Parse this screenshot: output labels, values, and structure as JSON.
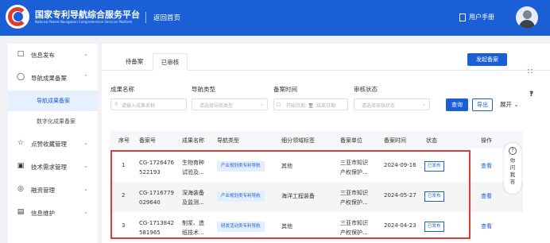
{
  "header": {
    "title": "国家专利导航综合服务平台",
    "subtitle": "National Patent Navigation Comprehensive Services Platform",
    "back_home": "返回首页",
    "manual": "用户手册",
    "brand_color": "#1b5fd6"
  },
  "sidebar": {
    "items": [
      {
        "label": "信息发布",
        "icon": "message-icon"
      },
      {
        "label": "导航成果备案",
        "icon": "shield-icon"
      },
      {
        "label": "点赞收藏管理",
        "icon": "star-icon"
      },
      {
        "label": "技术需求管理",
        "icon": "monitor-icon"
      },
      {
        "label": "融资管理",
        "icon": "target-icon"
      },
      {
        "label": "信息维护",
        "icon": "document-icon"
      }
    ],
    "sub_items": [
      {
        "label": "导航成果备案",
        "active": true
      },
      {
        "label": "数字化成果备案",
        "active": false
      }
    ]
  },
  "tabs": [
    "待备案",
    "已审核"
  ],
  "actions": {
    "launch": "发起备案",
    "query": "查询",
    "export": "导出",
    "expand": "展开"
  },
  "filters": {
    "result_name": {
      "label": "成果名称",
      "placeholder": "请输入成果名称"
    },
    "nav_type": {
      "label": "导航类型",
      "placeholder": "请选择导航类型"
    },
    "filing_time": {
      "label": "备案时间",
      "start": "开始日期",
      "to": "至",
      "end": "结束日期"
    },
    "audit_status": {
      "label": "审核状态",
      "placeholder": "请选择审核状态"
    }
  },
  "table": {
    "headers": [
      "序号",
      "备案号",
      "成果名称",
      "导航类型",
      "细分领域标签",
      "备案单位",
      "备案时间",
      "状态",
      "操作"
    ],
    "rows": [
      {
        "index": "1",
        "no1": "CG-1726476",
        "no2": "522193",
        "name1": "生物育种",
        "name2": "试验及...",
        "type": "产业规划类专利导航",
        "tag": "其他",
        "unit1": "三亚市知识",
        "unit2": "产权保护...",
        "date": "2024-09-16",
        "status": "已发布",
        "op": "查看"
      },
      {
        "index": "2",
        "no1": "CG-1716779",
        "no2": "029640",
        "name1": "深海装备",
        "name2": "及监测...",
        "type": "产业规划类专利导航",
        "tag": "海洋工程装备",
        "unit1": "三亚市知识",
        "unit2": "产权保护...",
        "date": "2024-05-27",
        "status": "已发布",
        "op": "查看"
      },
      {
        "index": "3",
        "no1": "CG-1713842",
        "no2": "581965",
        "name1": "制浆、造",
        "name2": "纸技术...",
        "type": "研发活动类专利导航",
        "tag": "其他",
        "unit1": "三亚市知识",
        "unit2": "产权保护...",
        "date": "2024-04-23",
        "status": "已发布",
        "op": "查看"
      }
    ]
  },
  "help": {
    "label": "你问我答"
  },
  "highlight_color": "#e53935"
}
